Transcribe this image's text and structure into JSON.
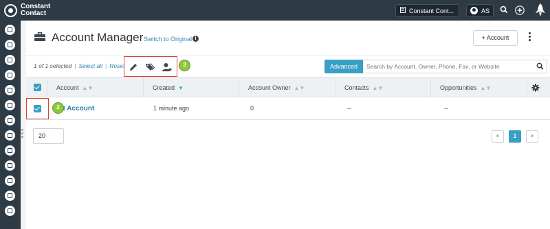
{
  "brand": {
    "line1": "Constant",
    "line2": "Contact"
  },
  "topbar": {
    "org_label": "Constant Cont...",
    "user_initials": "AS",
    "icons": [
      "building-icon",
      "user-icon",
      "search-icon",
      "plus-icon",
      "rocket-icon"
    ]
  },
  "sidebar": {
    "items": [
      "dashboard-icon",
      "email-icon",
      "clipboard-icon",
      "money-icon",
      "pipeline-icon",
      "list-icon",
      "megaphone-icon",
      "chat-icon",
      "thumbs-up-icon",
      "inbox-icon",
      "print-icon",
      "calendar-icon",
      "cloud-icon"
    ]
  },
  "header": {
    "title": "Account Manager",
    "switch_link": "Switch to Original",
    "add_button": "+ Account"
  },
  "toolbar": {
    "selected_text": "1 of 1 selected",
    "select_all": "Select all",
    "reset": "Reset",
    "advanced": "Advanced",
    "search_placeholder": "Search by Account, Owner, Phone, Fax, or Website",
    "callout_number": "3"
  },
  "table": {
    "columns": [
      "Account",
      "Created",
      "Account Owner",
      "Contacts",
      "Opportunities"
    ],
    "rows": [
      {
        "account": "Test Account",
        "account_visible": "st Account",
        "created": "1 minute ago",
        "owner": "0",
        "contacts": "--",
        "opportunities": "--"
      }
    ],
    "row_callout_number": "2"
  },
  "pagination": {
    "per_page": "20",
    "prev": "<",
    "current": "1",
    "next": ">"
  },
  "colors": {
    "topbar": "#2f3b44",
    "accent": "#3a9fc4",
    "highlight": "#e0412f",
    "callout": "#8dc63f"
  }
}
